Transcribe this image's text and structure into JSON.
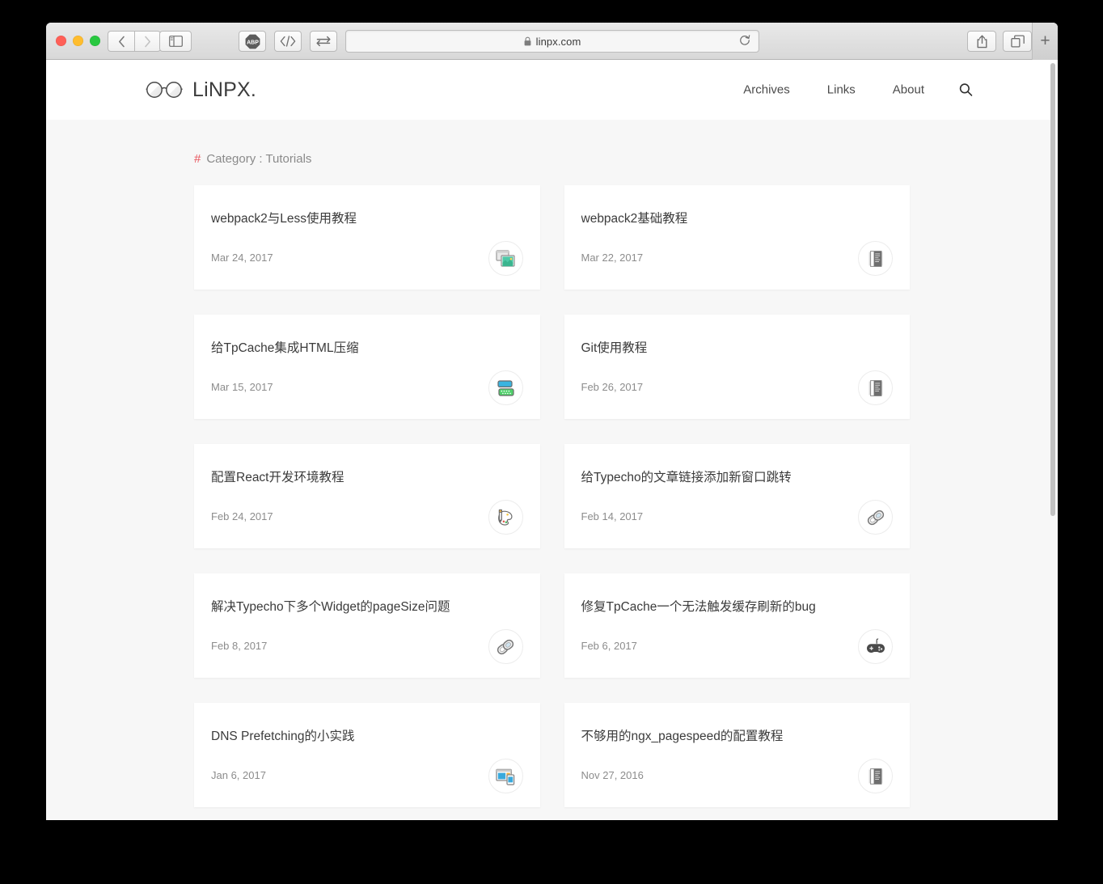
{
  "browser": {
    "url": "linpx.com",
    "lock_icon": "lock-icon",
    "reload_icon": "reload-icon",
    "back_icon": "chevron-left-icon",
    "forward_icon": "chevron-right-icon",
    "sidebar_icon": "sidebar-icon",
    "abp_label": "ABP",
    "code_icon": "code-icon",
    "sync_icon": "sync-arrows-icon",
    "share_icon": "share-icon",
    "tabs_icon": "tabs-overview-icon",
    "new_tab_label": "+"
  },
  "site": {
    "brand": "LiNPX.",
    "brand_icon": "glasses-logo-icon",
    "nav": [
      {
        "label": "Archives"
      },
      {
        "label": "Links"
      },
      {
        "label": "About"
      }
    ],
    "search_icon": "search-icon"
  },
  "page": {
    "category_hash": "#",
    "category_label": "Category : Tutorials",
    "accent_color": "#e8545c",
    "background_color": "#f7f7f7",
    "card_background": "#ffffff"
  },
  "posts": [
    {
      "title": "webpack2与Less使用教程",
      "date": "Mar 24, 2017",
      "icon": "photos-stack-icon"
    },
    {
      "title": "webpack2基础教程",
      "date": "Mar 22, 2017",
      "icon": "document-text-icon"
    },
    {
      "title": "给TpCache集成HTML压缩",
      "date": "Mar 15, 2017",
      "icon": "database-server-icon"
    },
    {
      "title": "Git使用教程",
      "date": "Feb 26, 2017",
      "icon": "document-text-icon"
    },
    {
      "title": "配置React开发环境教程",
      "date": "Feb 24, 2017",
      "icon": "paint-palette-icon"
    },
    {
      "title": "给Typecho的文章链接添加新窗口跳转",
      "date": "Feb 14, 2017",
      "icon": "chain-link-icon"
    },
    {
      "title": "解决Typecho下多个Widget的pageSize问题",
      "date": "Feb 8, 2017",
      "icon": "chain-link-icon"
    },
    {
      "title": "修复TpCache一个无法触发缓存刷新的bug",
      "date": "Feb 6, 2017",
      "icon": "game-controller-icon"
    },
    {
      "title": "DNS Prefetching的小实践",
      "date": "Jan 6, 2017",
      "icon": "responsive-devices-icon"
    },
    {
      "title": "不够用的ngx_pagespeed的配置教程",
      "date": "Nov 27, 2016",
      "icon": "document-text-icon"
    }
  ]
}
